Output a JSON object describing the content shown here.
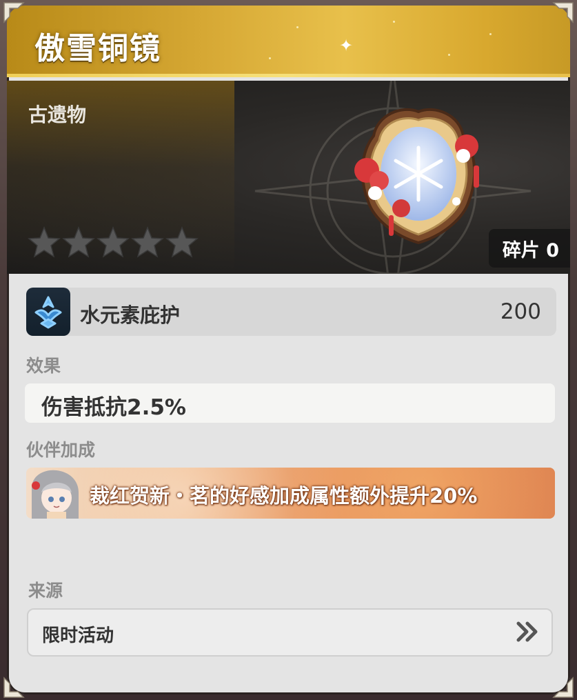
{
  "item": {
    "name": "傲雪铜镜",
    "category": "古遗物",
    "stars_total": 5,
    "stars_filled": 0,
    "shards_label": "碎片 0"
  },
  "attribute": {
    "icon": "hydro-element-icon",
    "name": "水元素庇护",
    "value": "200"
  },
  "effect": {
    "label": "效果",
    "text": "伤害抵抗2.5%"
  },
  "companion": {
    "label": "伙伴加成",
    "text": "裁红贺新・茗的好感加成属性额外提升20%"
  },
  "source": {
    "label": "来源",
    "text": "限时活动",
    "arrow_icon": "double-chevron-right-icon"
  },
  "colors": {
    "title_bar": "#d6a834",
    "panel_bg": "#e4e4e4",
    "hero_bg": "#2a2826",
    "text_dark": "#333333",
    "label_gray": "#8c8c8c"
  }
}
